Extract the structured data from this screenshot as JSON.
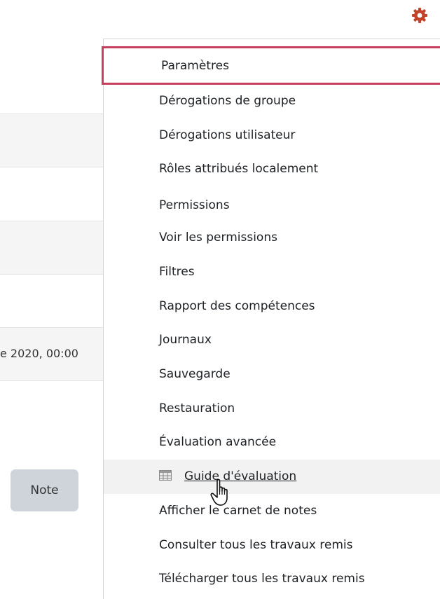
{
  "background": {
    "date_fragment": "e 2020, 00:00",
    "note_button_label": "Note"
  },
  "menu": {
    "icon": "gear-icon",
    "items": [
      {
        "label": "Paramètres",
        "state": "focused"
      },
      {
        "label": "Dérogations de groupe"
      },
      {
        "label": "Dérogations utilisateur"
      },
      {
        "label": "Rôles attribués localement"
      },
      {
        "label": "Permissions"
      },
      {
        "label": "Voir les permissions"
      },
      {
        "label": "Filtres"
      },
      {
        "label": "Rapport des compétences"
      },
      {
        "label": "Journaux"
      },
      {
        "label": "Sauvegarde"
      },
      {
        "label": "Restauration"
      },
      {
        "label": "Évaluation avancée"
      },
      {
        "label": "Guide d'évaluation",
        "state": "hovered",
        "icon": "grid-icon"
      },
      {
        "label": "Afficher le carnet de notes"
      },
      {
        "label": "Consulter tous les travaux remis"
      },
      {
        "label": "Télécharger tous les travaux remis"
      }
    ]
  },
  "colors": {
    "gear": "#c3432a",
    "focus_border": "#c83e5d",
    "hover_bg": "#f2f2f2",
    "note_button_bg": "#ced4da"
  },
  "cursor": "hand-pointer-icon"
}
